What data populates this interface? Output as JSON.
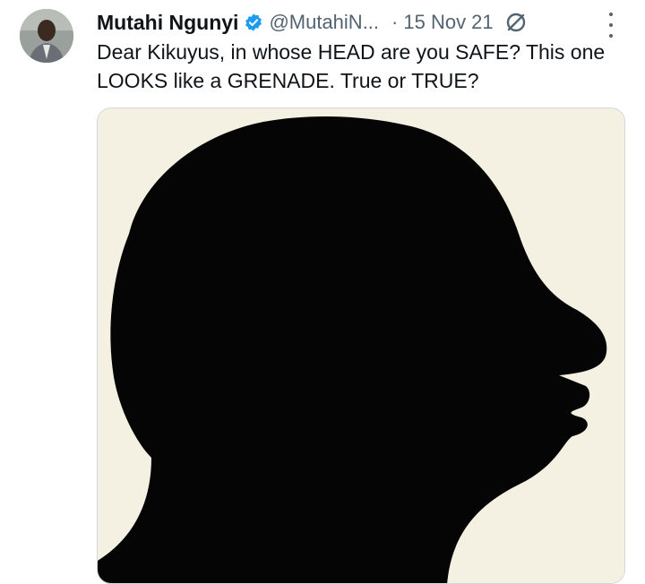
{
  "author": {
    "display_name": "Mutahi Ngunyi",
    "handle": "@MutahiN...",
    "verified": true,
    "avatar_icon": "profile-photo"
  },
  "meta": {
    "separator": "·",
    "date": "15 Nov 21",
    "edited_icon": "edited-icon",
    "more_icon": "more-vertical-icon"
  },
  "tweet": {
    "text": "Dear Kikuyus, in whose HEAD are you SAFE? This one LOOKS like a GRENADE. True or TRUE?"
  },
  "media": {
    "description_icon": "head-silhouette",
    "background_color": "#f4f1e2",
    "silhouette_color": "#050505"
  },
  "colors": {
    "verified_badge": "#1d9bf0",
    "secondary_text": "#536471",
    "primary_text": "#0f1419"
  }
}
